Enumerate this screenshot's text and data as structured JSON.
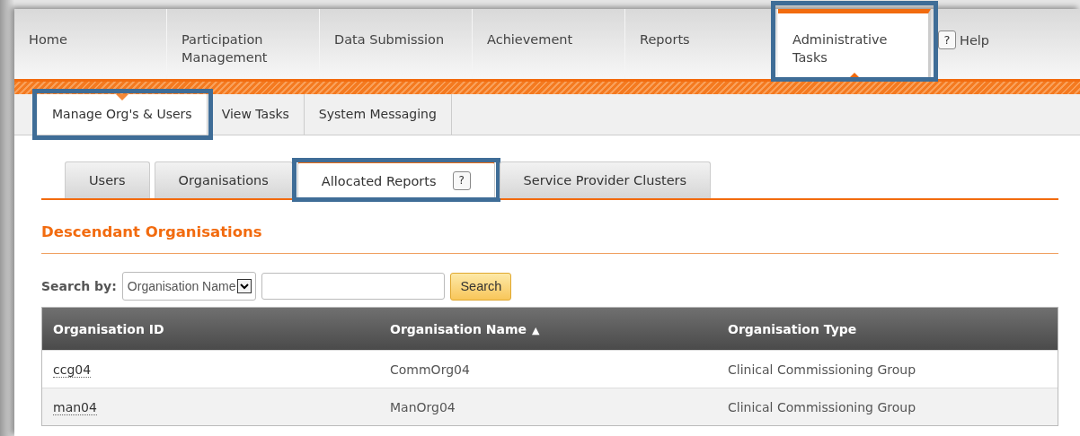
{
  "main_nav": [
    {
      "label": "Home",
      "selected": false,
      "highlighted": false
    },
    {
      "label": "Participation Management",
      "selected": false,
      "highlighted": false
    },
    {
      "label": "Data Submission",
      "selected": false,
      "highlighted": false
    },
    {
      "label": "Achievement",
      "selected": false,
      "highlighted": false
    },
    {
      "label": "Reports",
      "selected": false,
      "highlighted": false
    },
    {
      "label": "Administrative Tasks",
      "selected": true,
      "highlighted": true
    }
  ],
  "help": {
    "icon": "?",
    "label": "Help"
  },
  "sub_nav": [
    {
      "label": "Manage Org's & Users",
      "selected": true,
      "highlighted": true
    },
    {
      "label": "View Tasks",
      "selected": false,
      "highlighted": false
    },
    {
      "label": "System Messaging",
      "selected": false,
      "highlighted": false
    }
  ],
  "tabs": [
    {
      "label": "Users",
      "selected": false,
      "highlighted": false
    },
    {
      "label": "Organisations",
      "selected": false,
      "highlighted": false
    },
    {
      "label": "Allocated Reports",
      "selected": true,
      "highlighted": true,
      "help_icon": "?"
    },
    {
      "label": "Service Provider Clusters",
      "selected": false,
      "highlighted": false
    }
  ],
  "section_title": "Descendant Organisations",
  "search": {
    "label": "Search by:",
    "field": "Organisation Name",
    "button": "Search"
  },
  "table": {
    "columns": [
      {
        "label": "Organisation ID"
      },
      {
        "label": "Organisation Name",
        "sort": "▲"
      },
      {
        "label": "Organisation Type"
      }
    ],
    "rows": [
      [
        "ccg04",
        "CommOrg04",
        "Clinical Commissioning Group"
      ],
      [
        "man04",
        "ManOrg04",
        "Clinical Commissioning Group"
      ]
    ]
  }
}
